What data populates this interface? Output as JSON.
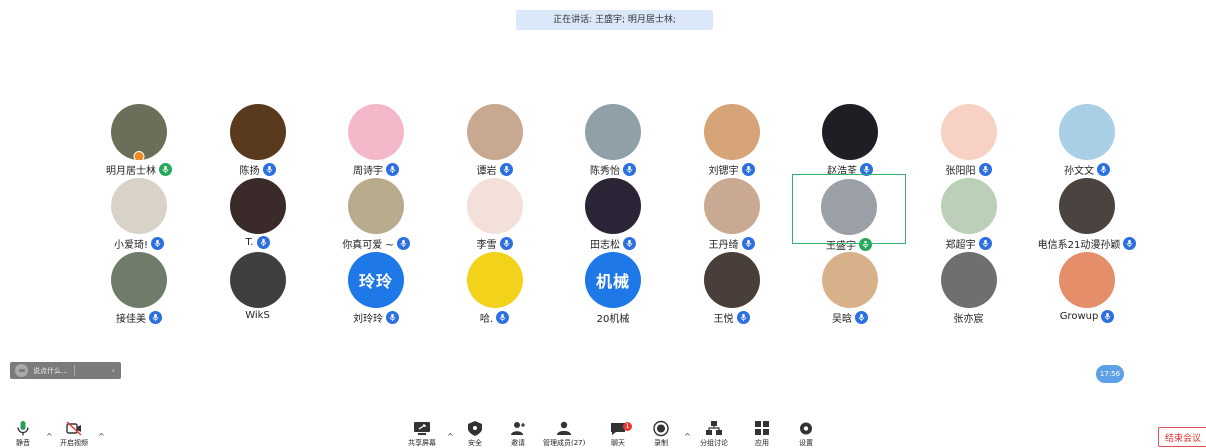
{
  "speaking": "正在讲话: 王盛宇; 明月居士林;",
  "participants": [
    {
      "name": "明月居士林",
      "mic": "active",
      "avatar_color": "#6b6f5a",
      "host": true
    },
    {
      "name": "陈扬",
      "mic": "muted",
      "avatar_color": "#5a3a1f"
    },
    {
      "name": "周诗宇",
      "mic": "muted",
      "avatar_color": "#f4b9c9"
    },
    {
      "name": "谭岩",
      "mic": "muted",
      "avatar_color": "#c9a892"
    },
    {
      "name": "陈秀怡",
      "mic": "muted",
      "avatar_color": "#8fa0a8"
    },
    {
      "name": "刘锶宇",
      "mic": "muted",
      "avatar_color": "#d7a47a"
    },
    {
      "name": "赵浩荃",
      "mic": "muted",
      "avatar_color": "#1e1e24"
    },
    {
      "name": "张阳阳",
      "mic": "muted",
      "avatar_color": "#f6d1c4"
    },
    {
      "name": "孙文文",
      "mic": "muted",
      "avatar_color": "#a9cfe6"
    },
    {
      "name": "小爱琦!",
      "mic": "muted",
      "avatar_color": "#d9d2c8"
    },
    {
      "name": "T.",
      "mic": "muted",
      "avatar_color": "#3a2a2a"
    },
    {
      "name": "你真可爱 ~",
      "mic": "muted",
      "avatar_color": "#b9ab8e"
    },
    {
      "name": "李雪",
      "mic": "muted",
      "avatar_color": "#f3e0d9"
    },
    {
      "name": "田志松",
      "mic": "muted",
      "avatar_color": "#2a2436"
    },
    {
      "name": "王丹绮",
      "mic": "muted",
      "avatar_color": "#caa993"
    },
    {
      "name": "王盛宇",
      "mic": "on",
      "avatar_color": "#9aa0a6",
      "active": true
    },
    {
      "name": "郑超宇",
      "mic": "muted",
      "avatar_color": "#bccfb8"
    },
    {
      "name": "电信系21动漫孙颖",
      "mic": "muted",
      "avatar_color": "#4b4340"
    },
    {
      "name": "接佳美",
      "mic": "muted",
      "avatar_color": "#6f7c6a"
    },
    {
      "name": "WikS",
      "mic": "none",
      "avatar_color": "#3f3f3f"
    },
    {
      "name": "刘玲玲",
      "mic": "muted",
      "avatar_color": "#1e78e8",
      "avatar_text": "玲玲"
    },
    {
      "name": "哈.",
      "mic": "muted",
      "avatar_color": "#f2d21a"
    },
    {
      "name": "20机械",
      "mic": "none",
      "avatar_color": "#1e78e8",
      "avatar_text": "机械"
    },
    {
      "name": "王悦",
      "mic": "muted",
      "avatar_color": "#4a3e3a"
    },
    {
      "name": "吴晗",
      "mic": "muted",
      "avatar_color": "#d8b08a"
    },
    {
      "name": "张亦宸",
      "mic": "none",
      "avatar_color": "#6d6f70"
    },
    {
      "name": "Growup",
      "mic": "muted",
      "avatar_color": "#e58f6a"
    }
  ],
  "chat_placeholder": "说点什么...",
  "time": "17:56",
  "toolbar": {
    "mute": "静音",
    "video": "开启视频",
    "share": "共享屏幕",
    "security": "安全",
    "invite": "邀请",
    "members": "管理成员(27)",
    "chat": "聊天",
    "chat_badge": "1",
    "record": "录制",
    "breakout": "分组讨论",
    "apps": "应用",
    "settings": "设置"
  },
  "end_meeting": "结束会议"
}
